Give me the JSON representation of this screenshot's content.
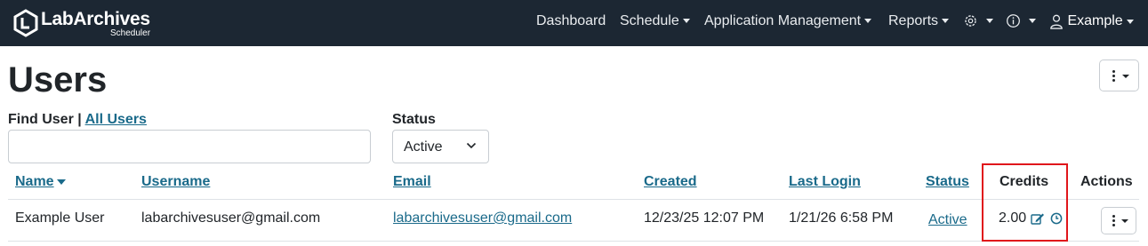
{
  "navbar": {
    "brand": "LabArchives",
    "brand_sub": "Scheduler",
    "items": [
      "Dashboard",
      "Schedule",
      "Application Management",
      "Reports"
    ],
    "user": "Example"
  },
  "page": {
    "title": "Users"
  },
  "filters": {
    "find_user_label": "Find User |",
    "all_users_link": "All Users",
    "find_user_value": "",
    "status_label": "Status",
    "status_value": "Active"
  },
  "table": {
    "columns": [
      "Name",
      "Username",
      "Email",
      "Created",
      "Last Login",
      "Status",
      "Credits",
      "Actions"
    ],
    "rows": [
      {
        "name": "Example User",
        "username": "labarchivesuser@gmail.com",
        "email": "labarchivesuser@gmail.com",
        "created": "12/23/25 12:07 PM",
        "last_login": "1/21/26 6:58 PM",
        "status": "Active",
        "credits": "2.00"
      }
    ]
  },
  "colors": {
    "navbar_bg": "#1c2733",
    "link": "#1a6a8a",
    "highlight_box": "#e0161b"
  }
}
